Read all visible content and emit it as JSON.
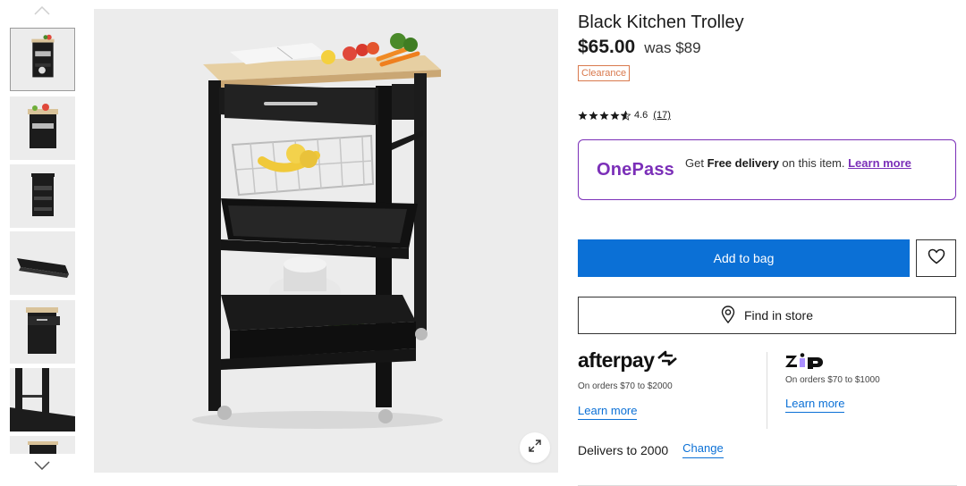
{
  "product": {
    "title": "Black Kitchen Trolley",
    "price": "$65.00",
    "was_price": "was $89",
    "badge": "Clearance",
    "rating": "4.6",
    "stars_value": 4.6,
    "review_count": "(17)"
  },
  "onepass": {
    "logo": "OnePass",
    "text_before": "Get ",
    "text_bold": "Free delivery",
    "text_after": " on this item. ",
    "link": "Learn more"
  },
  "actions": {
    "add_to_bag": "Add to bag",
    "find_in_store": "Find in store"
  },
  "afterpay": {
    "logo": "afterpay",
    "subtext": "On orders $70 to $2000",
    "learn_more": "Learn more"
  },
  "zip": {
    "logo": "zip",
    "subtext": "On orders $70 to $1000",
    "learn_more": "Learn more"
  },
  "delivery": {
    "text": "Delivers to 2000",
    "change": "Change"
  },
  "gallery": {
    "thumbnail_count": 7,
    "active_index": 0
  },
  "colors": {
    "primary_blue": "#0b70d6",
    "onepass_purple": "#7b2fb8",
    "clearance_orange": "#d9794d",
    "image_bg": "#ececec"
  },
  "icons": [
    "chevron-up-icon",
    "chevron-down-icon",
    "expand-icon",
    "heart-icon",
    "location-pin-icon",
    "star-icon",
    "afterpay-arrows-icon"
  ]
}
